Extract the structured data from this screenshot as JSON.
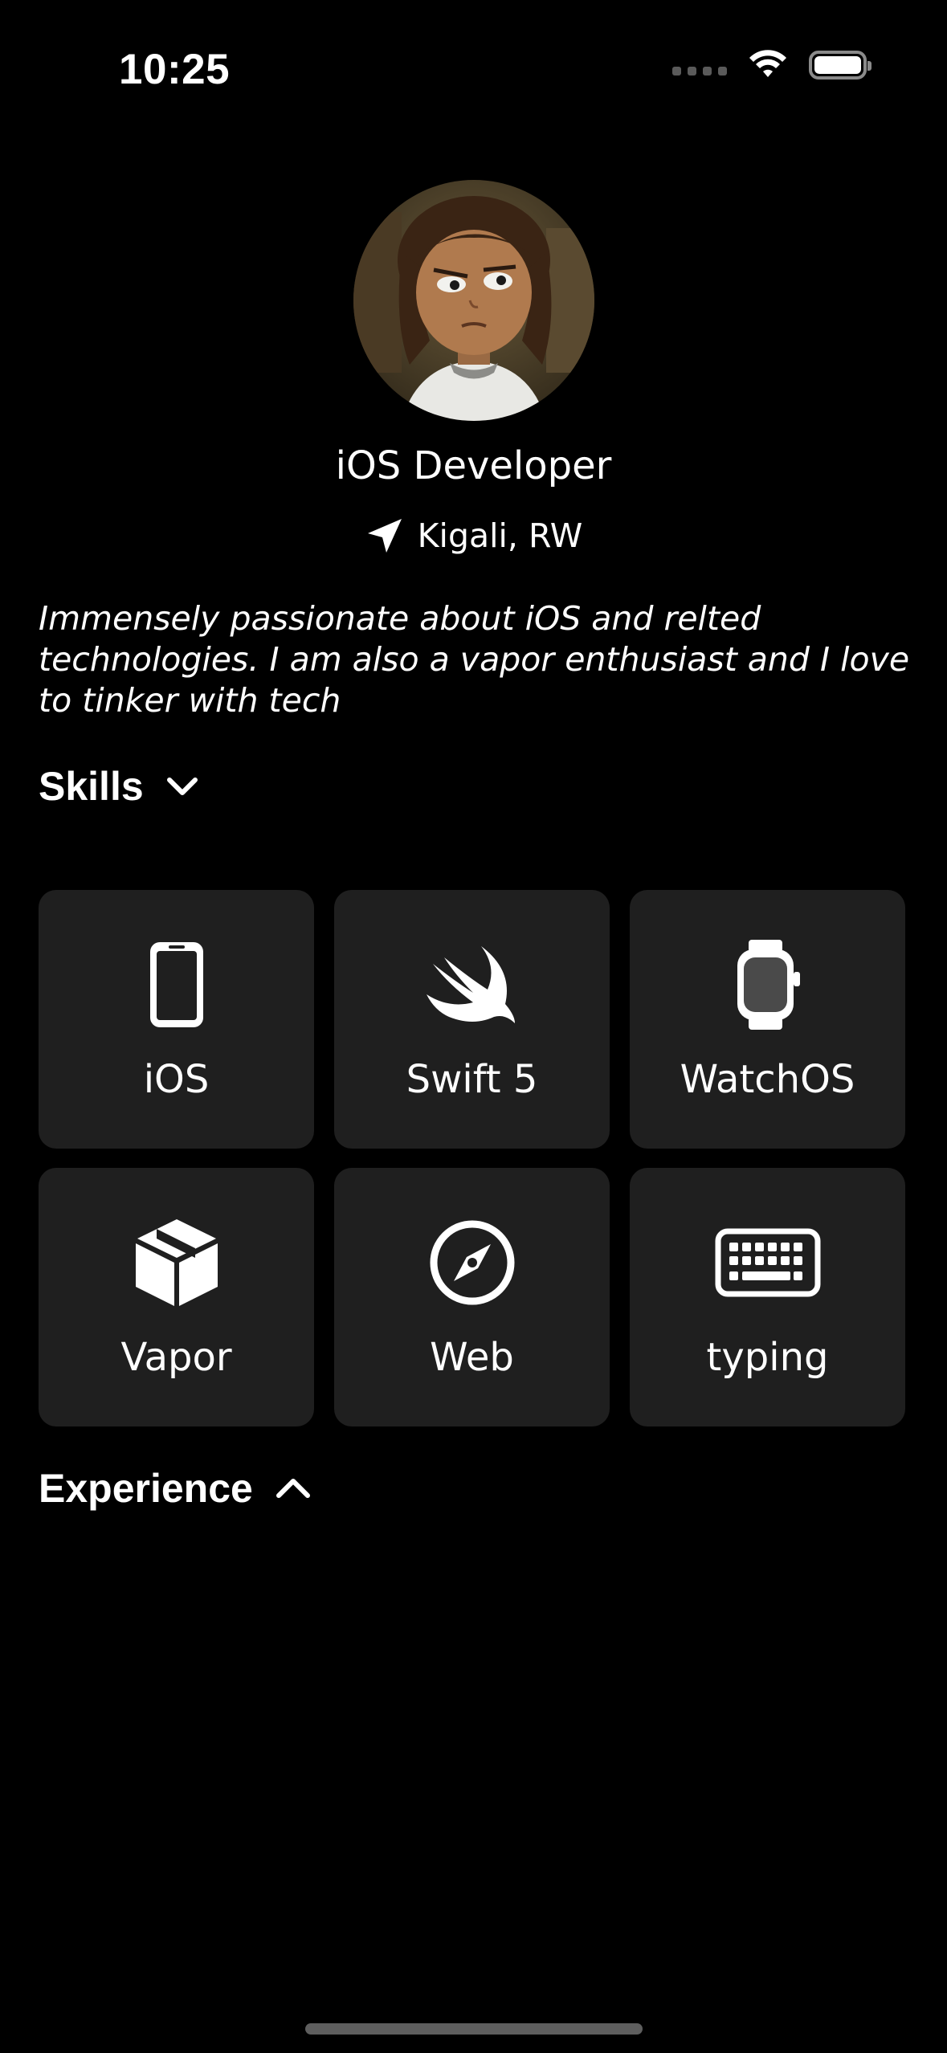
{
  "status_bar": {
    "time": "10:25"
  },
  "profile": {
    "title": "iOS Developer",
    "location": "Kigali, RW",
    "bio": "Immensely passionate about iOS and relted technologies. I am also a vapor enthusiast and I love to tinker with tech"
  },
  "skills_section": {
    "label": "Skills",
    "chevron": "chevron-down-icon",
    "items": [
      {
        "label": "iOS",
        "icon": "iphone-icon"
      },
      {
        "label": "Swift 5",
        "icon": "swift-icon"
      },
      {
        "label": "WatchOS",
        "icon": "applewatch-icon"
      },
      {
        "label": "Vapor",
        "icon": "cube-icon"
      },
      {
        "label": "Web",
        "icon": "safari-compass-icon"
      },
      {
        "label": "typing",
        "icon": "keyboard-icon"
      }
    ]
  },
  "experience_section": {
    "label": "Experience",
    "chevron": "chevron-up-icon"
  },
  "colors": {
    "background": "#000000",
    "card": "#1f1f1f",
    "text": "#ffffff"
  }
}
